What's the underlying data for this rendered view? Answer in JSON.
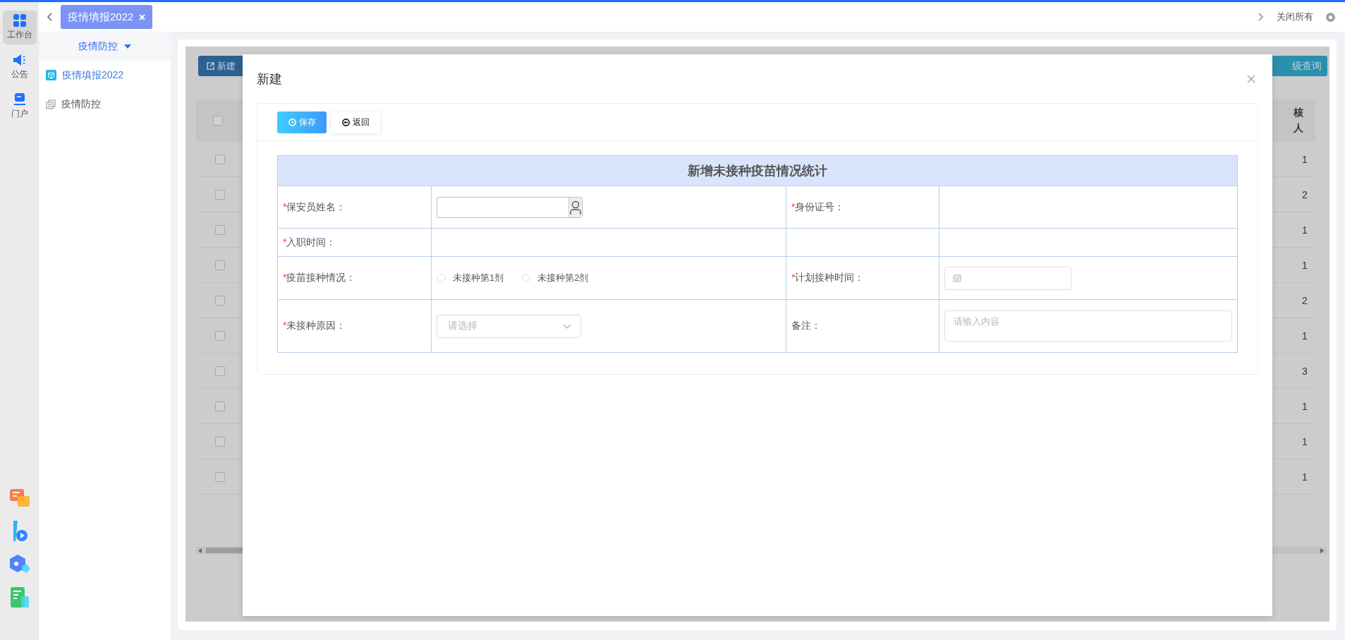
{
  "tabbar": {
    "tabs": [
      {
        "label": "疫情填报2022",
        "selected": true
      }
    ],
    "close_all": "关闭所有"
  },
  "rail": {
    "items": [
      {
        "label": "工作台",
        "selected": true
      },
      {
        "label": "公告",
        "selected": false
      },
      {
        "label": "门户",
        "selected": false
      }
    ]
  },
  "sidebar": {
    "header": "疫情防控",
    "expanded": true,
    "items": [
      {
        "label": "疫情填报2022",
        "selected": true
      },
      {
        "label": "疫情防控",
        "selected": false
      }
    ]
  },
  "background": {
    "new_button": "新建",
    "query_button": "级查询",
    "header_checked": false,
    "column_header": [
      "核",
      "人"
    ],
    "rows": [
      {
        "checked": false,
        "value": "1"
      },
      {
        "checked": false,
        "value": "2"
      },
      {
        "checked": false,
        "value": "1"
      },
      {
        "checked": false,
        "value": "1"
      },
      {
        "checked": false,
        "value": "2"
      },
      {
        "checked": false,
        "value": "1"
      },
      {
        "checked": false,
        "value": "3"
      },
      {
        "checked": false,
        "value": "1"
      },
      {
        "checked": false,
        "value": "1"
      },
      {
        "checked": false,
        "value": "1"
      }
    ]
  },
  "dialog": {
    "title": "新建",
    "toolbar": [
      {
        "label": "保存",
        "kind": "primary"
      },
      {
        "label": "返回",
        "kind": "default"
      }
    ],
    "form": {
      "title": "新增未接种疫苗情况统计",
      "rows": [
        {
          "fields": [
            {
              "required_mark": "*",
              "label": "保安员姓名：",
              "kind": "user-picker"
            },
            {
              "required_mark": "*",
              "label": "身份证号：",
              "kind": "text"
            }
          ]
        },
        {
          "fields": [
            {
              "required_mark": "*",
              "label": "入职时间：",
              "kind": "text"
            }
          ]
        },
        {
          "fields": [
            {
              "required_mark": "*",
              "label": "疫苗接种情况：",
              "kind": "radio",
              "options": [
                {
                  "label": "未接种第1剂",
                  "selected": false
                },
                {
                  "label": "未接种第2剂",
                  "selected": false
                }
              ]
            },
            {
              "required_mark": "*",
              "label": "计划接种时间：",
              "kind": "date"
            }
          ]
        },
        {
          "fields": [
            {
              "required_mark": "*",
              "label": "未接种原因：",
              "kind": "select",
              "placeholder": "请选择"
            },
            {
              "label": "备注：",
              "kind": "textarea",
              "placeholder": "请输入内容"
            }
          ]
        }
      ]
    }
  }
}
